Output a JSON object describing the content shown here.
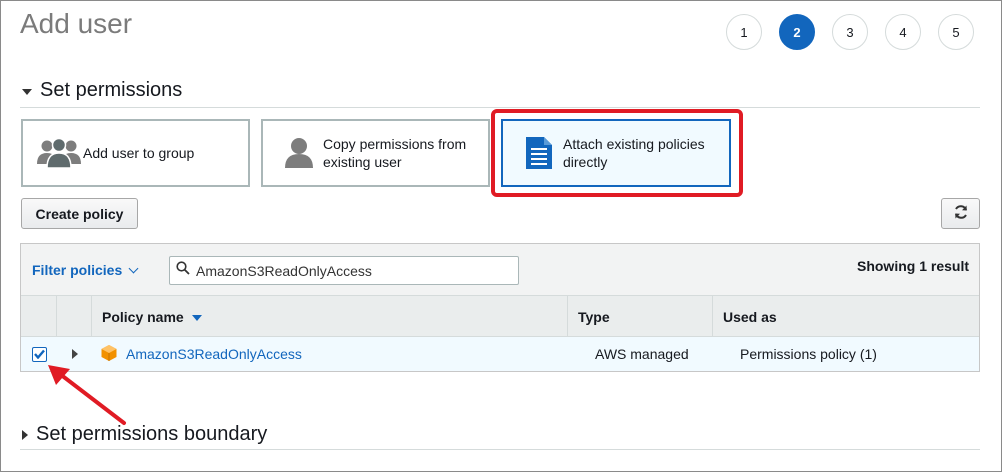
{
  "page": {
    "title": "Add user"
  },
  "steps": [
    "1",
    "2",
    "3",
    "4",
    "5"
  ],
  "active_step": "2",
  "permissions": {
    "section_title": "Set permissions",
    "options": [
      {
        "label": "Add user to group",
        "icon": "group-icon"
      },
      {
        "label": "Copy permissions from existing user",
        "icon": "user-icon"
      },
      {
        "label": "Attach existing policies directly",
        "icon": "document-icon",
        "selected": true
      }
    ]
  },
  "toolbar": {
    "create_policy_label": "Create policy",
    "refresh_icon": "refresh-icon"
  },
  "filter": {
    "label": "Filter policies",
    "search_value": "AmazonS3ReadOnlyAccess",
    "result_count": "Showing 1 result"
  },
  "table": {
    "columns": [
      "Policy name",
      "Type",
      "Used as"
    ],
    "rows": [
      {
        "name": "AmazonS3ReadOnlyAccess",
        "type": "AWS managed",
        "used_as": "Permissions policy (1)",
        "checked": true
      }
    ]
  },
  "boundary": {
    "section_title": "Set permissions boundary"
  },
  "colors": {
    "accent": "#1266bd",
    "highlight": "#e01b24",
    "policy_icon": "#f29100"
  }
}
